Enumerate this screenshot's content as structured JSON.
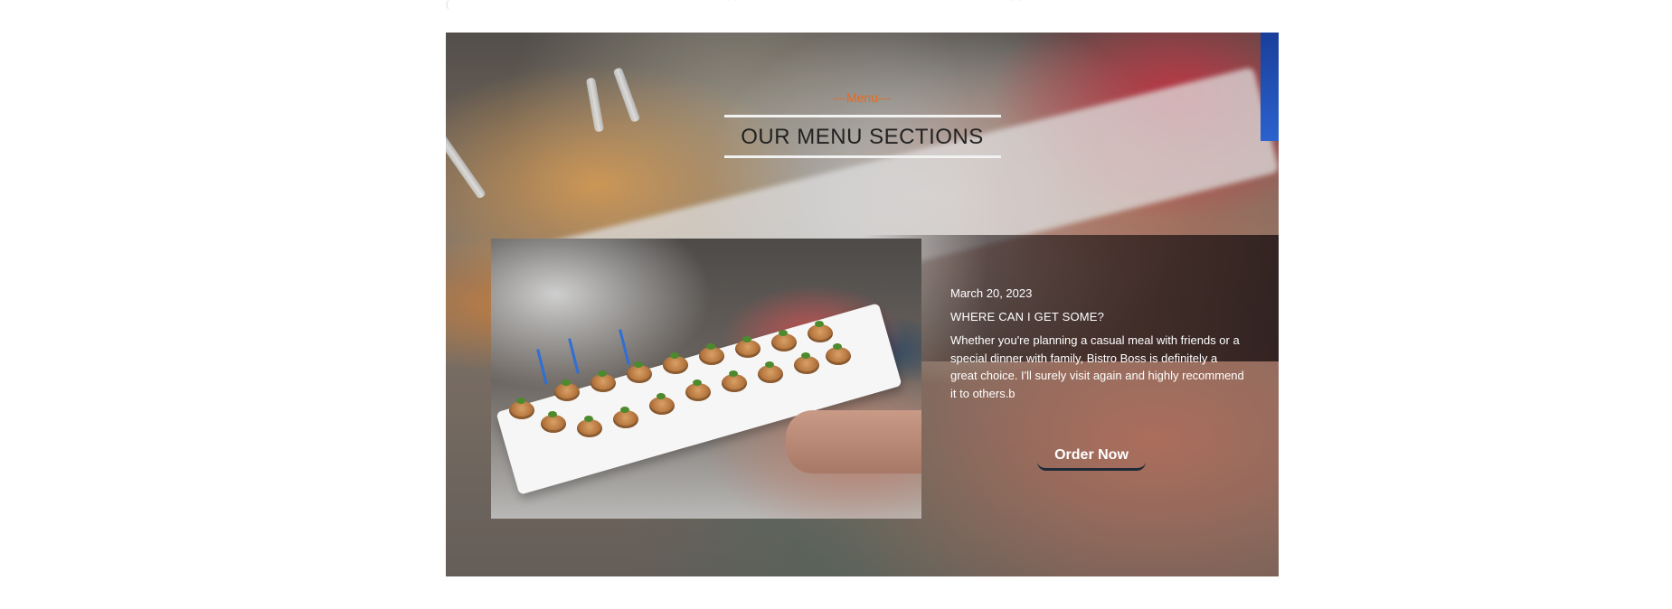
{
  "menu_section": {
    "subheading": "---Menu---",
    "title": "OUR MENU SECTIONS"
  },
  "featured_post": {
    "date": "March 20, 2023",
    "title": "WHERE CAN I GET SOME?",
    "body": "Whether you're planning a casual meal with friends or a special dinner with family, Bistro Boss is definitely a great choice. I'll surely visit again and highly recommend it to others.b",
    "cta_label": "Order Now"
  },
  "images": {
    "background": "catering-platter-photo",
    "inset": "appetizer-tray-photo"
  },
  "colors": {
    "accent": "#e8691f",
    "title_text": "#222222",
    "button_border": "#1f2937"
  }
}
